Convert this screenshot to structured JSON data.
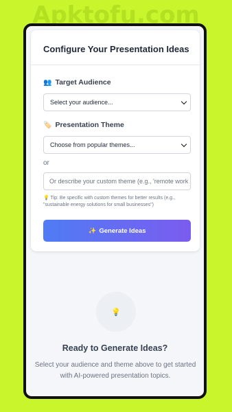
{
  "watermark": "Apktofu.com",
  "form": {
    "title": "Configure Your Presentation Ideas",
    "audience": {
      "icon": "👥",
      "label": "Target Audience",
      "selected": "Select your audience..."
    },
    "theme": {
      "icon": "🏷️",
      "label": "Presentation Theme",
      "selected": "Choose from popular themes..."
    },
    "or_text": "or",
    "custom_theme_placeholder": "Or describe your custom theme (e.g., 'remote work c",
    "tip_icon": "💡",
    "tip_text": "Tip: Be specific with custom themes for better results (e.g., \"sustainable energy solutions for small businesses\")",
    "generate_icon": "✨",
    "generate_label": "Generate Ideas"
  },
  "empty_state": {
    "icon": "💡",
    "title": "Ready to Generate Ideas?",
    "subtitle": "Select your audience and theme above to get started with AI-powered presentation topics."
  },
  "colors": {
    "background": "#c8f52c",
    "button_gradient_start": "#4f7cf5",
    "button_gradient_end": "#7b5cf0"
  }
}
